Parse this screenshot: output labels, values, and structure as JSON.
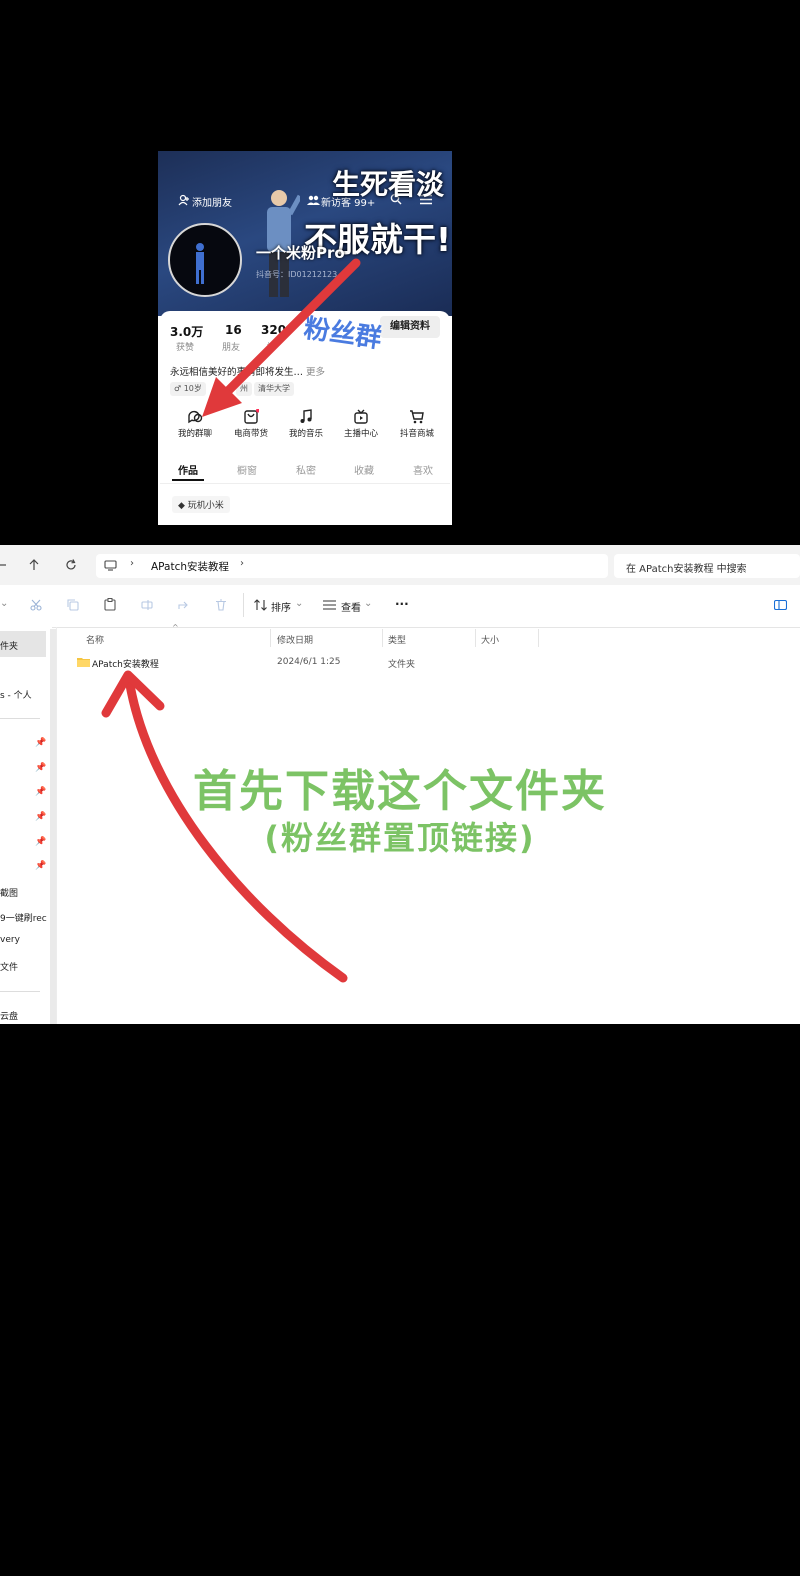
{
  "phone": {
    "add_friend": "添加朋友",
    "visitors": "新访客 99+",
    "slogan_top": "生死看淡",
    "slogan_main": "不服就干!",
    "username": "一个米粉Pro",
    "douyin_id": "抖音号：ID01212123",
    "stats": [
      {
        "num": "3.0万",
        "label": "获赞"
      },
      {
        "num": "16",
        "label": "朋友"
      },
      {
        "num": "320",
        "label": "关"
      }
    ],
    "edit_profile": "编辑资料",
    "fans_group_overlay": "粉丝群",
    "bio": "永远相信美好的事情即将发生…",
    "bio_more": "更多",
    "tags": [
      "♂ 10岁",
      "州",
      "清华大学"
    ],
    "services": [
      {
        "label": "我的群聊",
        "icon": "group-chat-icon"
      },
      {
        "label": "电商带货",
        "icon": "shopping-bag-icon"
      },
      {
        "label": "我的音乐",
        "icon": "music-note-icon"
      },
      {
        "label": "主播中心",
        "icon": "live-tv-icon"
      },
      {
        "label": "抖音商城",
        "icon": "cart-icon"
      }
    ],
    "tabs": [
      "作品",
      "橱窗",
      "私密",
      "收藏",
      "喜欢"
    ],
    "collection_pill": "玩机小米"
  },
  "explorer": {
    "breadcrumb": "APatch安装教程",
    "search_placeholder": "在 APatch安装教程 中搜索",
    "sort_label": "排序",
    "view_label": "查看",
    "more_label": "···",
    "columns": [
      "名称",
      "修改日期",
      "类型",
      "大小"
    ],
    "rows": [
      {
        "name": "APatch安装教程",
        "date": "2024/6/1 1:25",
        "type": "文件夹",
        "size": ""
      }
    ],
    "nav_items": [
      {
        "label": "件夹",
        "pinned": false
      },
      {
        "label": "s - 个人",
        "pinned": false
      },
      {
        "label": "",
        "pinned": true
      },
      {
        "label": "",
        "pinned": true
      },
      {
        "label": "",
        "pinned": true
      },
      {
        "label": "",
        "pinned": true
      },
      {
        "label": "",
        "pinned": true
      },
      {
        "label": "",
        "pinned": true
      },
      {
        "label": "截图",
        "pinned": false
      },
      {
        "label": "9一键刷rec",
        "pinned": false
      },
      {
        "label": "very",
        "pinned": false
      },
      {
        "label": "文件",
        "pinned": false
      },
      {
        "label": "云盘",
        "pinned": false
      }
    ],
    "overlay_title": "首先下载这个文件夹",
    "overlay_subtitle": "(粉丝群置顶链接)"
  },
  "colors": {
    "arrow_red": "#e0393b",
    "caption_green": "#7cc365",
    "folder_yellow": "#f5c542"
  }
}
